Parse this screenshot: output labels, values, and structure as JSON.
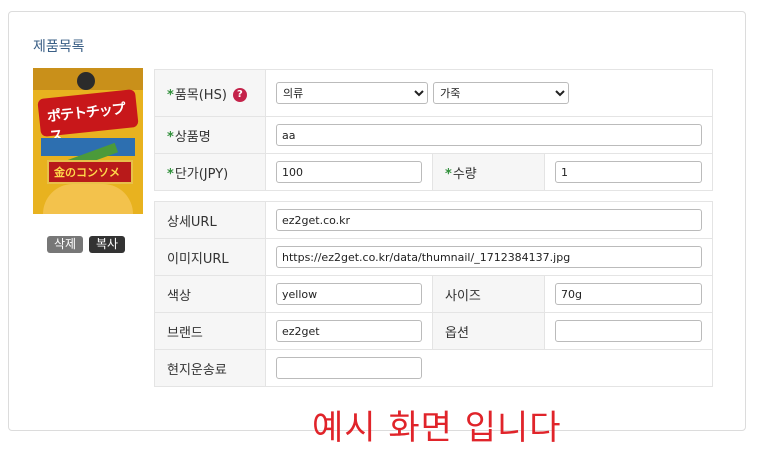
{
  "section_title": "제품목록",
  "product": {
    "image_alt_brand": "KOIKEYA POTATO CHIPS",
    "image_text": "ポテトチップス",
    "image_band": "金のコンソメ",
    "delete_label": "삭제",
    "copy_label": "복사"
  },
  "form": {
    "required_mark": "*",
    "hs": {
      "label": "품목(HS)",
      "help": "?",
      "category_selected": "의류",
      "subcategory_selected": "가죽"
    },
    "name": {
      "label": "상품명",
      "value": "aa"
    },
    "price": {
      "label": "단가(JPY)",
      "value": "100"
    },
    "quantity": {
      "label": "수량",
      "value": "1"
    },
    "detail_url": {
      "label": "상세URL",
      "value": "ez2get.co.kr"
    },
    "image_url": {
      "label": "이미지URL",
      "value": "https://ez2get.co.kr/data/thumnail/_1712384137.jpg"
    },
    "color": {
      "label": "색상",
      "value": "yellow"
    },
    "size": {
      "label": "사이즈",
      "value": "70g"
    },
    "brand": {
      "label": "브랜드",
      "value": "ez2get"
    },
    "option": {
      "label": "옵션",
      "value": ""
    },
    "local_shipping": {
      "label": "현지운송료",
      "value": ""
    }
  },
  "watermark": "예시 화면 입니다"
}
